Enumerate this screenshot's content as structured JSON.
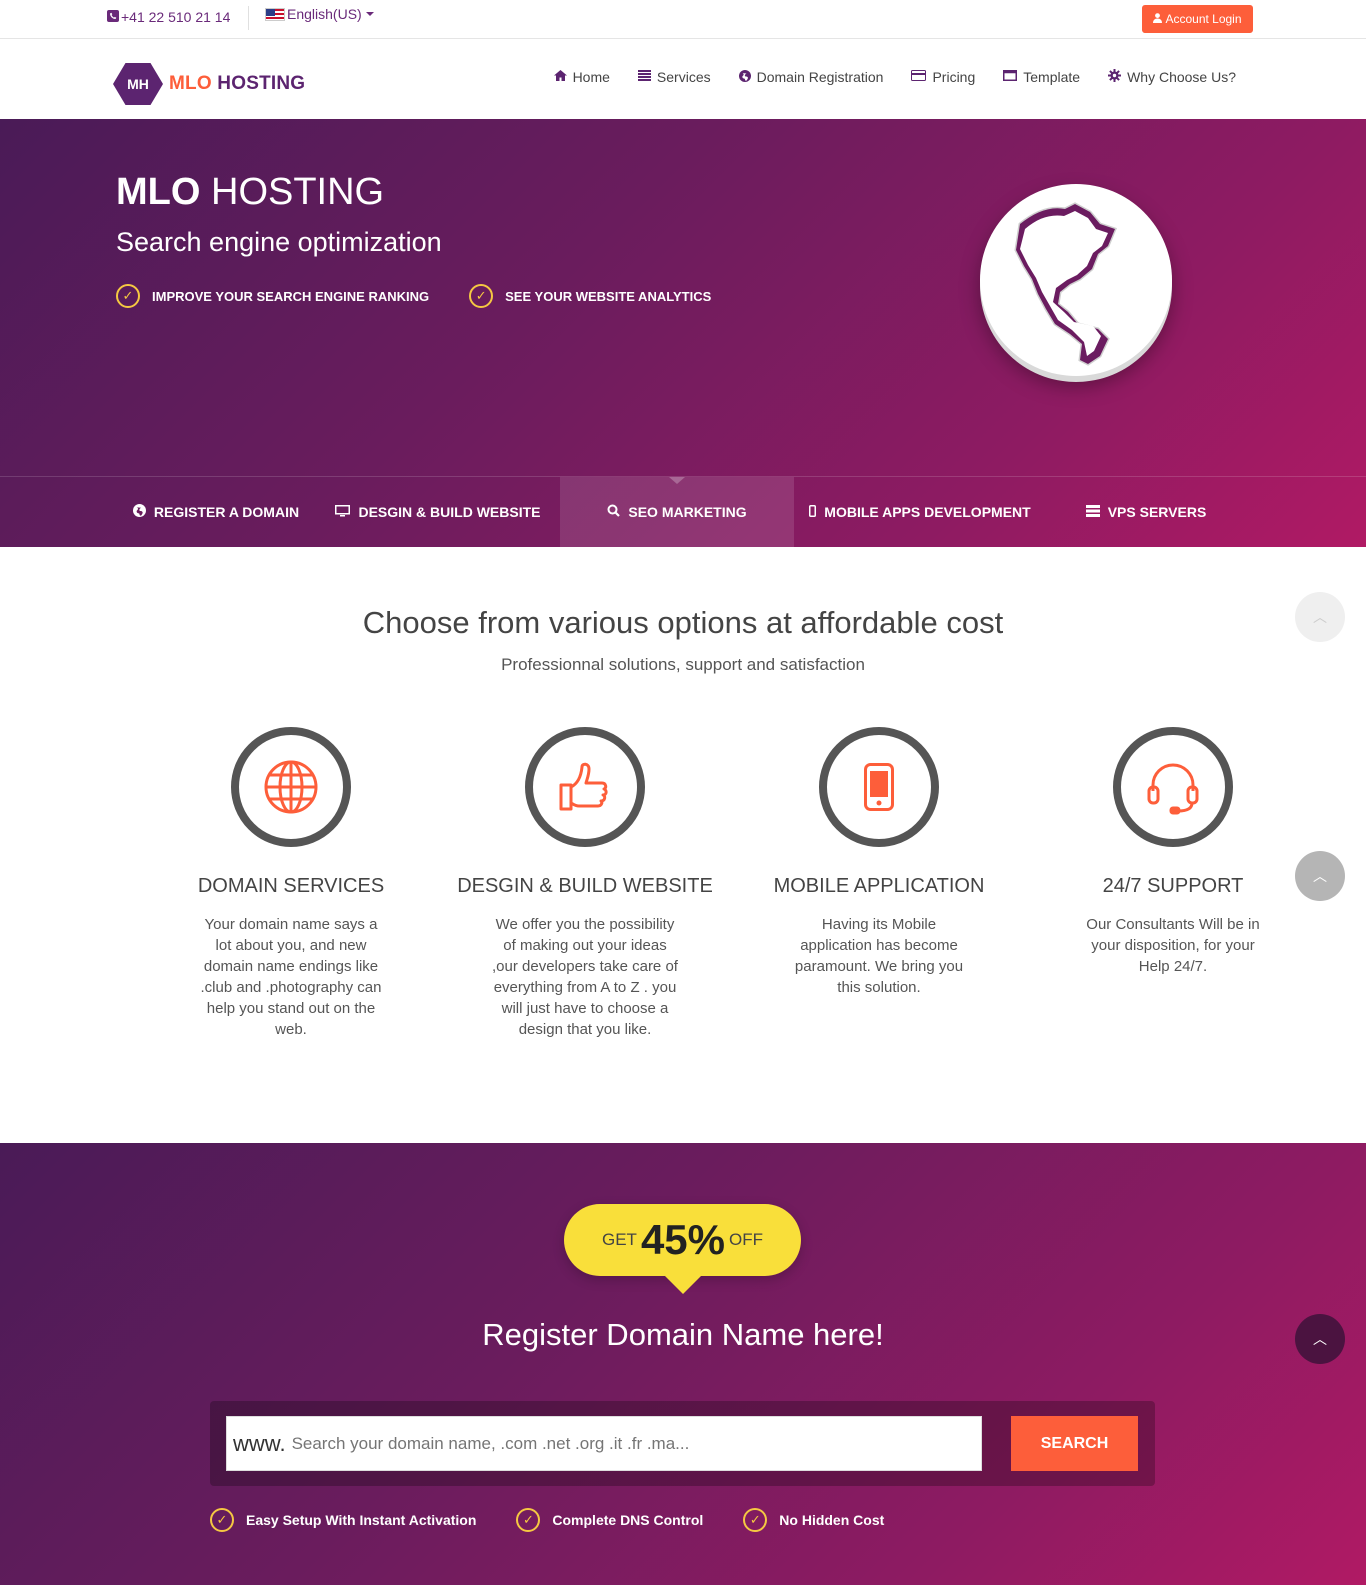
{
  "topbar": {
    "phone": "+41 22 510 21 14",
    "language": "English(US)",
    "login_label": "Account Login"
  },
  "logo": {
    "badge": "MH",
    "name_part1": "MLO",
    "name_part2": "HOSTING"
  },
  "nav": [
    {
      "label": "Home",
      "icon": "home-icon"
    },
    {
      "label": "Services",
      "icon": "list-icon"
    },
    {
      "label": "Domain Registration",
      "icon": "globe-icon"
    },
    {
      "label": "Pricing",
      "icon": "credit-card-icon"
    },
    {
      "label": "Template",
      "icon": "window-icon"
    },
    {
      "label": "Why Choose Us?",
      "icon": "gear-icon"
    }
  ],
  "hero": {
    "title_bold": "MLO",
    "title_rest": "HOSTING",
    "subtitle": "Search engine optimization",
    "features": [
      "IMPROVE YOUR SEARCH ENGINE RANKING",
      "SEE YOUR WEBSITE ANALYTICS"
    ]
  },
  "tabs": [
    {
      "label": "REGISTER A DOMAIN",
      "icon": "globe-icon",
      "active": false
    },
    {
      "label": "DESGIN & BUILD WEBSITE",
      "icon": "monitor-icon",
      "active": false
    },
    {
      "label": "SEO MARKETING",
      "icon": "search-icon",
      "active": true
    },
    {
      "label": "MOBILE APPS DEVELOPMENT",
      "icon": "mobile-icon",
      "active": false
    },
    {
      "label": "VPS SERVERS",
      "icon": "server-icon",
      "active": false
    }
  ],
  "options": {
    "title": "Choose from various options at affordable cost",
    "subtitle": "Professionnal solutions, support and satisfaction",
    "cards": [
      {
        "title": "DOMAIN SERVICES",
        "icon": "globe-icon",
        "text": "Your domain name says a lot about you, and new domain name endings like .club and .photography can help you stand out on the web."
      },
      {
        "title": "DESGIN & BUILD WEBSITE",
        "icon": "thumbs-up-icon",
        "text": "We offer you the possibility of making out your ideas ,our developers take care of everything from A to Z . you will just have to choose a design that you like."
      },
      {
        "title": "MOBILE APPLICATION",
        "icon": "mobile-icon",
        "text": "Having its Mobile application has become paramount. We bring you this solution."
      },
      {
        "title": "24/7 SUPPORT",
        "icon": "headset-icon",
        "text": "Our Consultants Will be in your disposition, for your Help 24/7."
      }
    ]
  },
  "register": {
    "promo_get": "GET",
    "promo_value": "45%",
    "promo_off": "OFF",
    "title": "Register Domain Name here!",
    "prefix": "www.",
    "placeholder": "Search your domain name, .com .net .org .it .fr .ma...",
    "search_label": "SEARCH",
    "features": [
      "Easy Setup With Instant Activation",
      "Complete DNS Control",
      "No Hidden Cost"
    ]
  },
  "colors": {
    "accent": "#fd5e3a",
    "brand": "#5c2470",
    "highlight": "#f9df3a"
  }
}
